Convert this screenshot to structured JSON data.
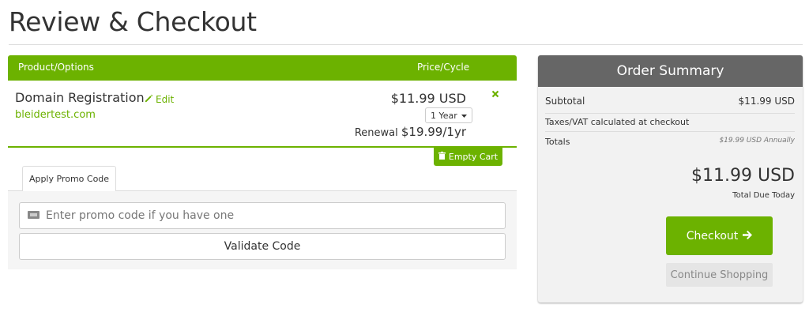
{
  "page": {
    "title": "Review & Checkout"
  },
  "cart": {
    "header": {
      "product_col": "Product/Options",
      "price_col": "Price/Cycle"
    },
    "item": {
      "name": "Domain Registration",
      "edit_label": "Edit",
      "domain": "bleidertest.com",
      "price": "$11.99 USD",
      "cycle": "1 Year",
      "renewal_label": "Renewal",
      "renewal_value": "$19.99/1yr"
    },
    "empty_cart_label": "Empty Cart"
  },
  "promo": {
    "tab_label": "Apply Promo Code",
    "placeholder": "Enter promo code if you have one",
    "validate_label": "Validate Code"
  },
  "summary": {
    "title": "Order Summary",
    "subtotal_label": "Subtotal",
    "subtotal_value": "$11.99 USD",
    "taxes_label": "Taxes/VAT calculated at checkout",
    "totals_label": "Totals",
    "totals_value": "$19.99 USD Annually",
    "total_amount": "$11.99 USD",
    "total_due_label": "Total Due Today",
    "checkout_label": "Checkout",
    "continue_label": "Continue Shopping"
  },
  "colors": {
    "accent": "#6cb200",
    "summary_header": "#666666"
  },
  "icons": [
    "pencil-icon",
    "close-icon",
    "caret-down-icon",
    "trash-icon",
    "ticket-icon",
    "arrow-right-icon"
  ]
}
